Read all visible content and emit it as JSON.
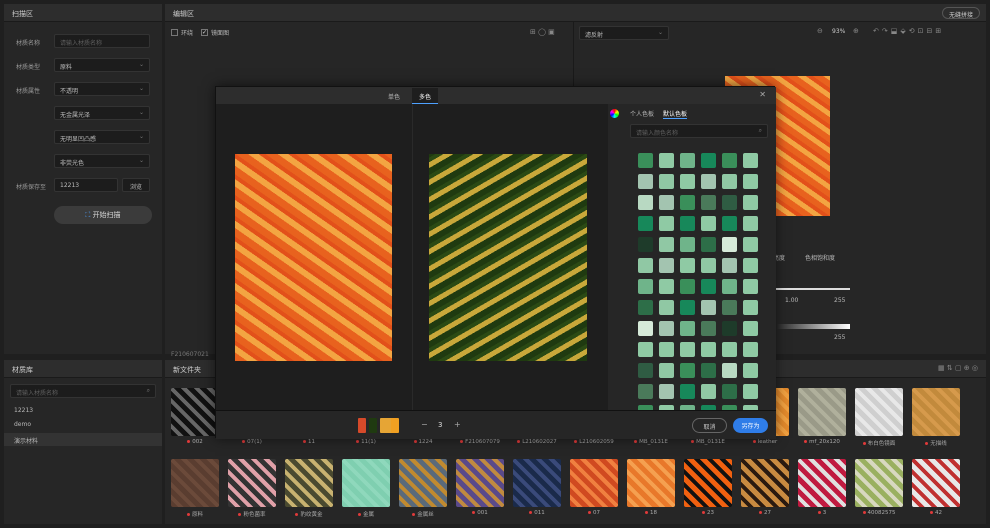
{
  "scan_panel": {
    "title": "扫描区",
    "fields": [
      {
        "label": "材质名称",
        "placeholder": "请输入材质名称"
      },
      {
        "label": "材质类型",
        "value": "原料"
      },
      {
        "label": "材质属性",
        "value": "不透明"
      },
      {
        "label": "",
        "value": "无金属光泽"
      },
      {
        "label": "",
        "value": "无明显凹凸感"
      },
      {
        "label": "",
        "value": "非荧光色"
      },
      {
        "label": "材质保存至",
        "value": "12213",
        "extra": "浏览"
      }
    ],
    "start_button": "开始扫描"
  },
  "edit_panel": {
    "title": "编辑区",
    "check_ring": "环绕",
    "check_mirror": "镜面图",
    "filter": "滤反射",
    "zoom": "93%",
    "top_right": "无缝拼接",
    "file_label": "F210607021",
    "sliders": {
      "a": "亮度",
      "b": "色相饱和度",
      "v1": "1.00",
      "v2": "255",
      "v3": "255"
    }
  },
  "library": {
    "title": "材质库",
    "search_placeholder": "请输入材质名称",
    "items": [
      "12213",
      "demo",
      "演示材料"
    ],
    "folder": "新文件夹"
  },
  "dialog": {
    "tabs": [
      "单色",
      "多色"
    ],
    "active_tab": "多色",
    "palette_tabs": [
      "个人色板",
      "默认色板"
    ],
    "palette_search": "请输入颜色名称",
    "count": "3",
    "cancel": "取消",
    "save_as": "另存为"
  },
  "swatch_colors": [
    "#3a8f5a",
    "#2d6e48",
    "#b8d9c2",
    "#8fcaa4",
    "#1e3b2a",
    "#4a7a5a",
    "#6fb48a",
    "#a3c4b0",
    "#d6ead9",
    "#17885a",
    "#2f5c43",
    "#90c8a4"
  ],
  "picked_colors": [
    "#d64a2a",
    "#1f3a10",
    "#e6a535",
    "#f0a022"
  ],
  "row1": [
    {
      "name": "002",
      "c1": "#111",
      "c2": "#666"
    },
    {
      "name": "07(1)",
      "c1": "#e85a1c",
      "c2": "#f3a542"
    },
    {
      "name": "11",
      "c1": "#2a2a2a",
      "c2": "#444"
    },
    {
      "name": "11(1)",
      "c1": "#2a2a2a",
      "c2": "#444"
    },
    {
      "name": "1224",
      "c1": "#2a2a2a",
      "c2": "#444"
    },
    {
      "name": "F210607079",
      "c1": "#2a2a2a",
      "c2": "#444"
    },
    {
      "name": "L210602027",
      "c1": "#2a2a2a",
      "c2": "#444"
    },
    {
      "name": "L210602059",
      "c1": "#2a2a2a",
      "c2": "#444"
    },
    {
      "name": "MB_0131E",
      "c1": "#2a2a2a",
      "c2": "#444"
    },
    {
      "name": "MB_0131E",
      "c1": "#2a2a2a",
      "c2": "#444"
    },
    {
      "name": "leather",
      "c1": "#e38a2c",
      "c2": "#f0a040"
    },
    {
      "name": "mf_20x120",
      "c1": "#9a9a88",
      "c2": "#b0b09c"
    },
    {
      "name": "布白色镜面",
      "c1": "#cfcfcf",
      "c2": "#e8e8e8"
    },
    {
      "name": "无描线",
      "c1": "#c28a3c",
      "c2": "#d69a4c"
    }
  ],
  "row2": [
    {
      "name": "原料",
      "c1": "#5a3d30",
      "c2": "#6b4a3a"
    },
    {
      "name": "粉色菌率",
      "c1": "#333",
      "c2": "#e0a0a8"
    },
    {
      "name": "豹纹黄金",
      "c1": "#4a4a30",
      "c2": "#c8b270"
    },
    {
      "name": "金属",
      "c1": "#7fcfb0",
      "c2": "#8fd8bc"
    },
    {
      "name": "金属丝",
      "c1": "#5a6a7a",
      "c2": "#c08a30"
    },
    {
      "name": "001",
      "c1": "#5a4a8a",
      "c2": "#c08a40"
    },
    {
      "name": "011",
      "c1": "#1a2a4a",
      "c2": "#3a4a7a"
    },
    {
      "name": "07",
      "c1": "#d04a20",
      "c2": "#f08040"
    },
    {
      "name": "18",
      "c1": "#e8782a",
      "c2": "#f5a050"
    },
    {
      "name": "23",
      "c1": "#f06010",
      "c2": "#111"
    },
    {
      "name": "27",
      "c1": "#c88a40",
      "c2": "#2a1a10"
    },
    {
      "name": "3",
      "c1": "#c01a40",
      "c2": "#e0e0e0"
    },
    {
      "name": "40082575",
      "c1": "#9ab060",
      "c2": "#d8d8c0"
    },
    {
      "name": "42",
      "c1": "#e8e8e8",
      "c2": "#c03030"
    }
  ]
}
